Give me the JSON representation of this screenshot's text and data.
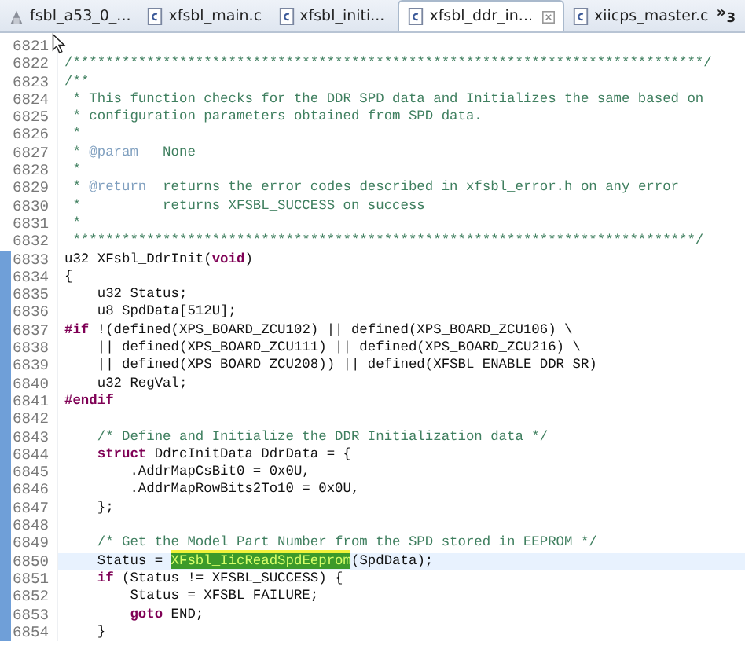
{
  "tabs": [
    {
      "label": "fsbl_a53_0_...",
      "kind": "project",
      "selected": false
    },
    {
      "label": "xfsbl_main.c",
      "kind": "c-file",
      "selected": false
    },
    {
      "label": "xfsbl_initi...",
      "kind": "c-file",
      "selected": false
    },
    {
      "label": "xfsbl_ddr_in...",
      "kind": "c-file",
      "selected": true
    },
    {
      "label": "xiicps_master.c",
      "kind": "c-file",
      "selected": false
    }
  ],
  "overflow": "»$_{3}$",
  "lines": [
    {
      "number": "6821",
      "in_range": false,
      "current": false
    },
    {
      "number": "6822",
      "in_range": false,
      "current": false,
      "tokens": [
        {
          "kind": "comment",
          "text": "/*****************************************************************************/"
        }
      ]
    },
    {
      "number": "6823",
      "in_range": false,
      "current": false,
      "tokens": [
        {
          "kind": "comment",
          "text": "/**"
        }
      ]
    },
    {
      "number": "6824",
      "in_range": false,
      "current": false,
      "tokens": [
        {
          "kind": "comment",
          "text": " * This function checks for the DDR SPD data and Initializes the same based on"
        }
      ]
    },
    {
      "number": "6825",
      "in_range": false,
      "current": false,
      "tokens": [
        {
          "kind": "comment",
          "text": " * configuration parameters obtained from SPD data."
        }
      ]
    },
    {
      "number": "6826",
      "in_range": false,
      "current": false,
      "tokens": [
        {
          "kind": "comment",
          "text": " *"
        }
      ]
    },
    {
      "number": "6827",
      "in_range": false,
      "current": false,
      "tokens": [
        {
          "kind": "comment",
          "text": " * "
        },
        {
          "kind": "doctag",
          "text": "@param"
        },
        {
          "kind": "comment",
          "text": "   None"
        }
      ]
    },
    {
      "number": "6828",
      "in_range": false,
      "current": false,
      "tokens": [
        {
          "kind": "comment",
          "text": " *"
        }
      ]
    },
    {
      "number": "6829",
      "in_range": false,
      "current": false,
      "tokens": [
        {
          "kind": "comment",
          "text": " * "
        },
        {
          "kind": "doctag",
          "text": "@return"
        },
        {
          "kind": "comment",
          "text": "  returns the error codes described in xfsbl_error.h on any error"
        }
      ]
    },
    {
      "number": "6830",
      "in_range": false,
      "current": false,
      "tokens": [
        {
          "kind": "comment",
          "text": " *          returns XFSBL_SUCCESS on success"
        }
      ]
    },
    {
      "number": "6831",
      "in_range": false,
      "current": false,
      "tokens": [
        {
          "kind": "comment",
          "text": " *"
        }
      ]
    },
    {
      "number": "6832",
      "in_range": false,
      "current": false,
      "tokens": [
        {
          "kind": "comment",
          "text": " ****************************************************************************/"
        }
      ]
    },
    {
      "number": "6833",
      "in_range": true,
      "current": false,
      "tokens": [
        {
          "kind": "plain",
          "text": "u32 XFsbl_DdrInit("
        },
        {
          "kind": "keyword",
          "text": "void"
        },
        {
          "kind": "plain",
          "text": ")"
        }
      ]
    },
    {
      "number": "6834",
      "in_range": true,
      "current": false,
      "tokens": [
        {
          "kind": "plain",
          "text": "{"
        }
      ]
    },
    {
      "number": "6835",
      "in_range": true,
      "current": false,
      "tokens": [
        {
          "kind": "plain",
          "text": "    u32 Status;"
        }
      ]
    },
    {
      "number": "6836",
      "in_range": true,
      "current": false,
      "tokens": [
        {
          "kind": "plain",
          "text": "    u8 SpdData[512U];"
        }
      ]
    },
    {
      "number": "6837",
      "in_range": true,
      "current": false,
      "tokens": [
        {
          "kind": "keyword",
          "text": "#if"
        },
        {
          "kind": "plain",
          "text": " !(defined(XPS_BOARD_ZCU102) || defined(XPS_BOARD_ZCU106) \\"
        }
      ]
    },
    {
      "number": "6838",
      "in_range": true,
      "current": false,
      "tokens": [
        {
          "kind": "plain",
          "text": "    || defined(XPS_BOARD_ZCU111) || defined(XPS_BOARD_ZCU216) \\"
        }
      ]
    },
    {
      "number": "6839",
      "in_range": true,
      "current": false,
      "tokens": [
        {
          "kind": "plain",
          "text": "    || defined(XPS_BOARD_ZCU208)) || defined(XFSBL_ENABLE_DDR_SR)"
        }
      ]
    },
    {
      "number": "6840",
      "in_range": true,
      "current": false,
      "tokens": [
        {
          "kind": "plain",
          "text": "    u32 RegVal;"
        }
      ]
    },
    {
      "number": "6841",
      "in_range": true,
      "current": false,
      "tokens": [
        {
          "kind": "keyword",
          "text": "#endif"
        }
      ]
    },
    {
      "number": "6842",
      "in_range": true,
      "current": false
    },
    {
      "number": "6843",
      "in_range": true,
      "current": false,
      "tokens": [
        {
          "kind": "comment",
          "text": "    /* Define and Initialize the DDR Initialization data */"
        }
      ]
    },
    {
      "number": "6844",
      "in_range": true,
      "current": false,
      "tokens": [
        {
          "kind": "keyword",
          "text": "    struct"
        },
        {
          "kind": "plain",
          "text": " DdrcInitData DdrData = {"
        }
      ]
    },
    {
      "number": "6845",
      "in_range": true,
      "current": false,
      "tokens": [
        {
          "kind": "plain",
          "text": "        .AddrMapCsBit0 = 0x0U,"
        }
      ]
    },
    {
      "number": "6846",
      "in_range": true,
      "current": false,
      "tokens": [
        {
          "kind": "plain",
          "text": "        .AddrMapRowBits2To10 = 0x0U,"
        }
      ]
    },
    {
      "number": "6847",
      "in_range": true,
      "current": false,
      "tokens": [
        {
          "kind": "plain",
          "text": "    };"
        }
      ]
    },
    {
      "number": "6848",
      "in_range": true,
      "current": false
    },
    {
      "number": "6849",
      "in_range": true,
      "current": false,
      "tokens": [
        {
          "kind": "comment",
          "text": "    /* Get the Model Part Number from the SPD stored in EEPROM */"
        }
      ]
    },
    {
      "number": "6850",
      "in_range": true,
      "current": true,
      "tokens": [
        {
          "kind": "plain",
          "text": "    Status = "
        },
        {
          "kind": "match",
          "text": "XFsbl_IicReadSpdEeprom"
        },
        {
          "kind": "plain",
          "text": "(SpdData);"
        }
      ]
    },
    {
      "number": "6851",
      "in_range": true,
      "current": false,
      "tokens": [
        {
          "kind": "keyword",
          "text": "    if"
        },
        {
          "kind": "plain",
          "text": " (Status != XFSBL_SUCCESS) {"
        }
      ]
    },
    {
      "number": "6852",
      "in_range": true,
      "current": false,
      "tokens": [
        {
          "kind": "plain",
          "text": "        Status = XFSBL_FAILURE;"
        }
      ]
    },
    {
      "number": "6853",
      "in_range": true,
      "current": false,
      "tokens": [
        {
          "kind": "keyword",
          "text": "        goto"
        },
        {
          "kind": "plain",
          "text": " END;"
        }
      ]
    },
    {
      "number": "6854",
      "in_range": true,
      "current": false,
      "tokens": [
        {
          "kind": "plain",
          "text": "    }"
        }
      ]
    }
  ]
}
